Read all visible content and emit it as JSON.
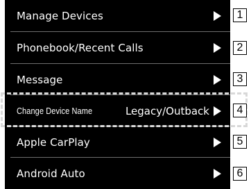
{
  "menu": {
    "items": [
      {
        "label": "Manage Devices",
        "value": "",
        "arrow_icon": "triangle-right-icon"
      },
      {
        "label": "Phonebook/Recent Calls",
        "value": "",
        "arrow_icon": "triangle-right-icon"
      },
      {
        "label": "Message",
        "value": "",
        "arrow_icon": "triangle-right-icon"
      },
      {
        "label": "Change Device Name",
        "value": "Legacy/Outback",
        "arrow_icon": "triangle-right-icon"
      },
      {
        "label": "Apple CarPlay",
        "value": "",
        "arrow_icon": "triangle-right-icon"
      },
      {
        "label": "Android Auto",
        "value": "",
        "arrow_icon": "triangle-right-icon"
      }
    ]
  },
  "callouts": [
    "1",
    "2",
    "3",
    "4",
    "5",
    "6"
  ],
  "colors": {
    "screen_background": "#000000",
    "text": "#ffffff",
    "divider": "#6e6e6e",
    "highlight_dash": "#d8d8d8"
  }
}
